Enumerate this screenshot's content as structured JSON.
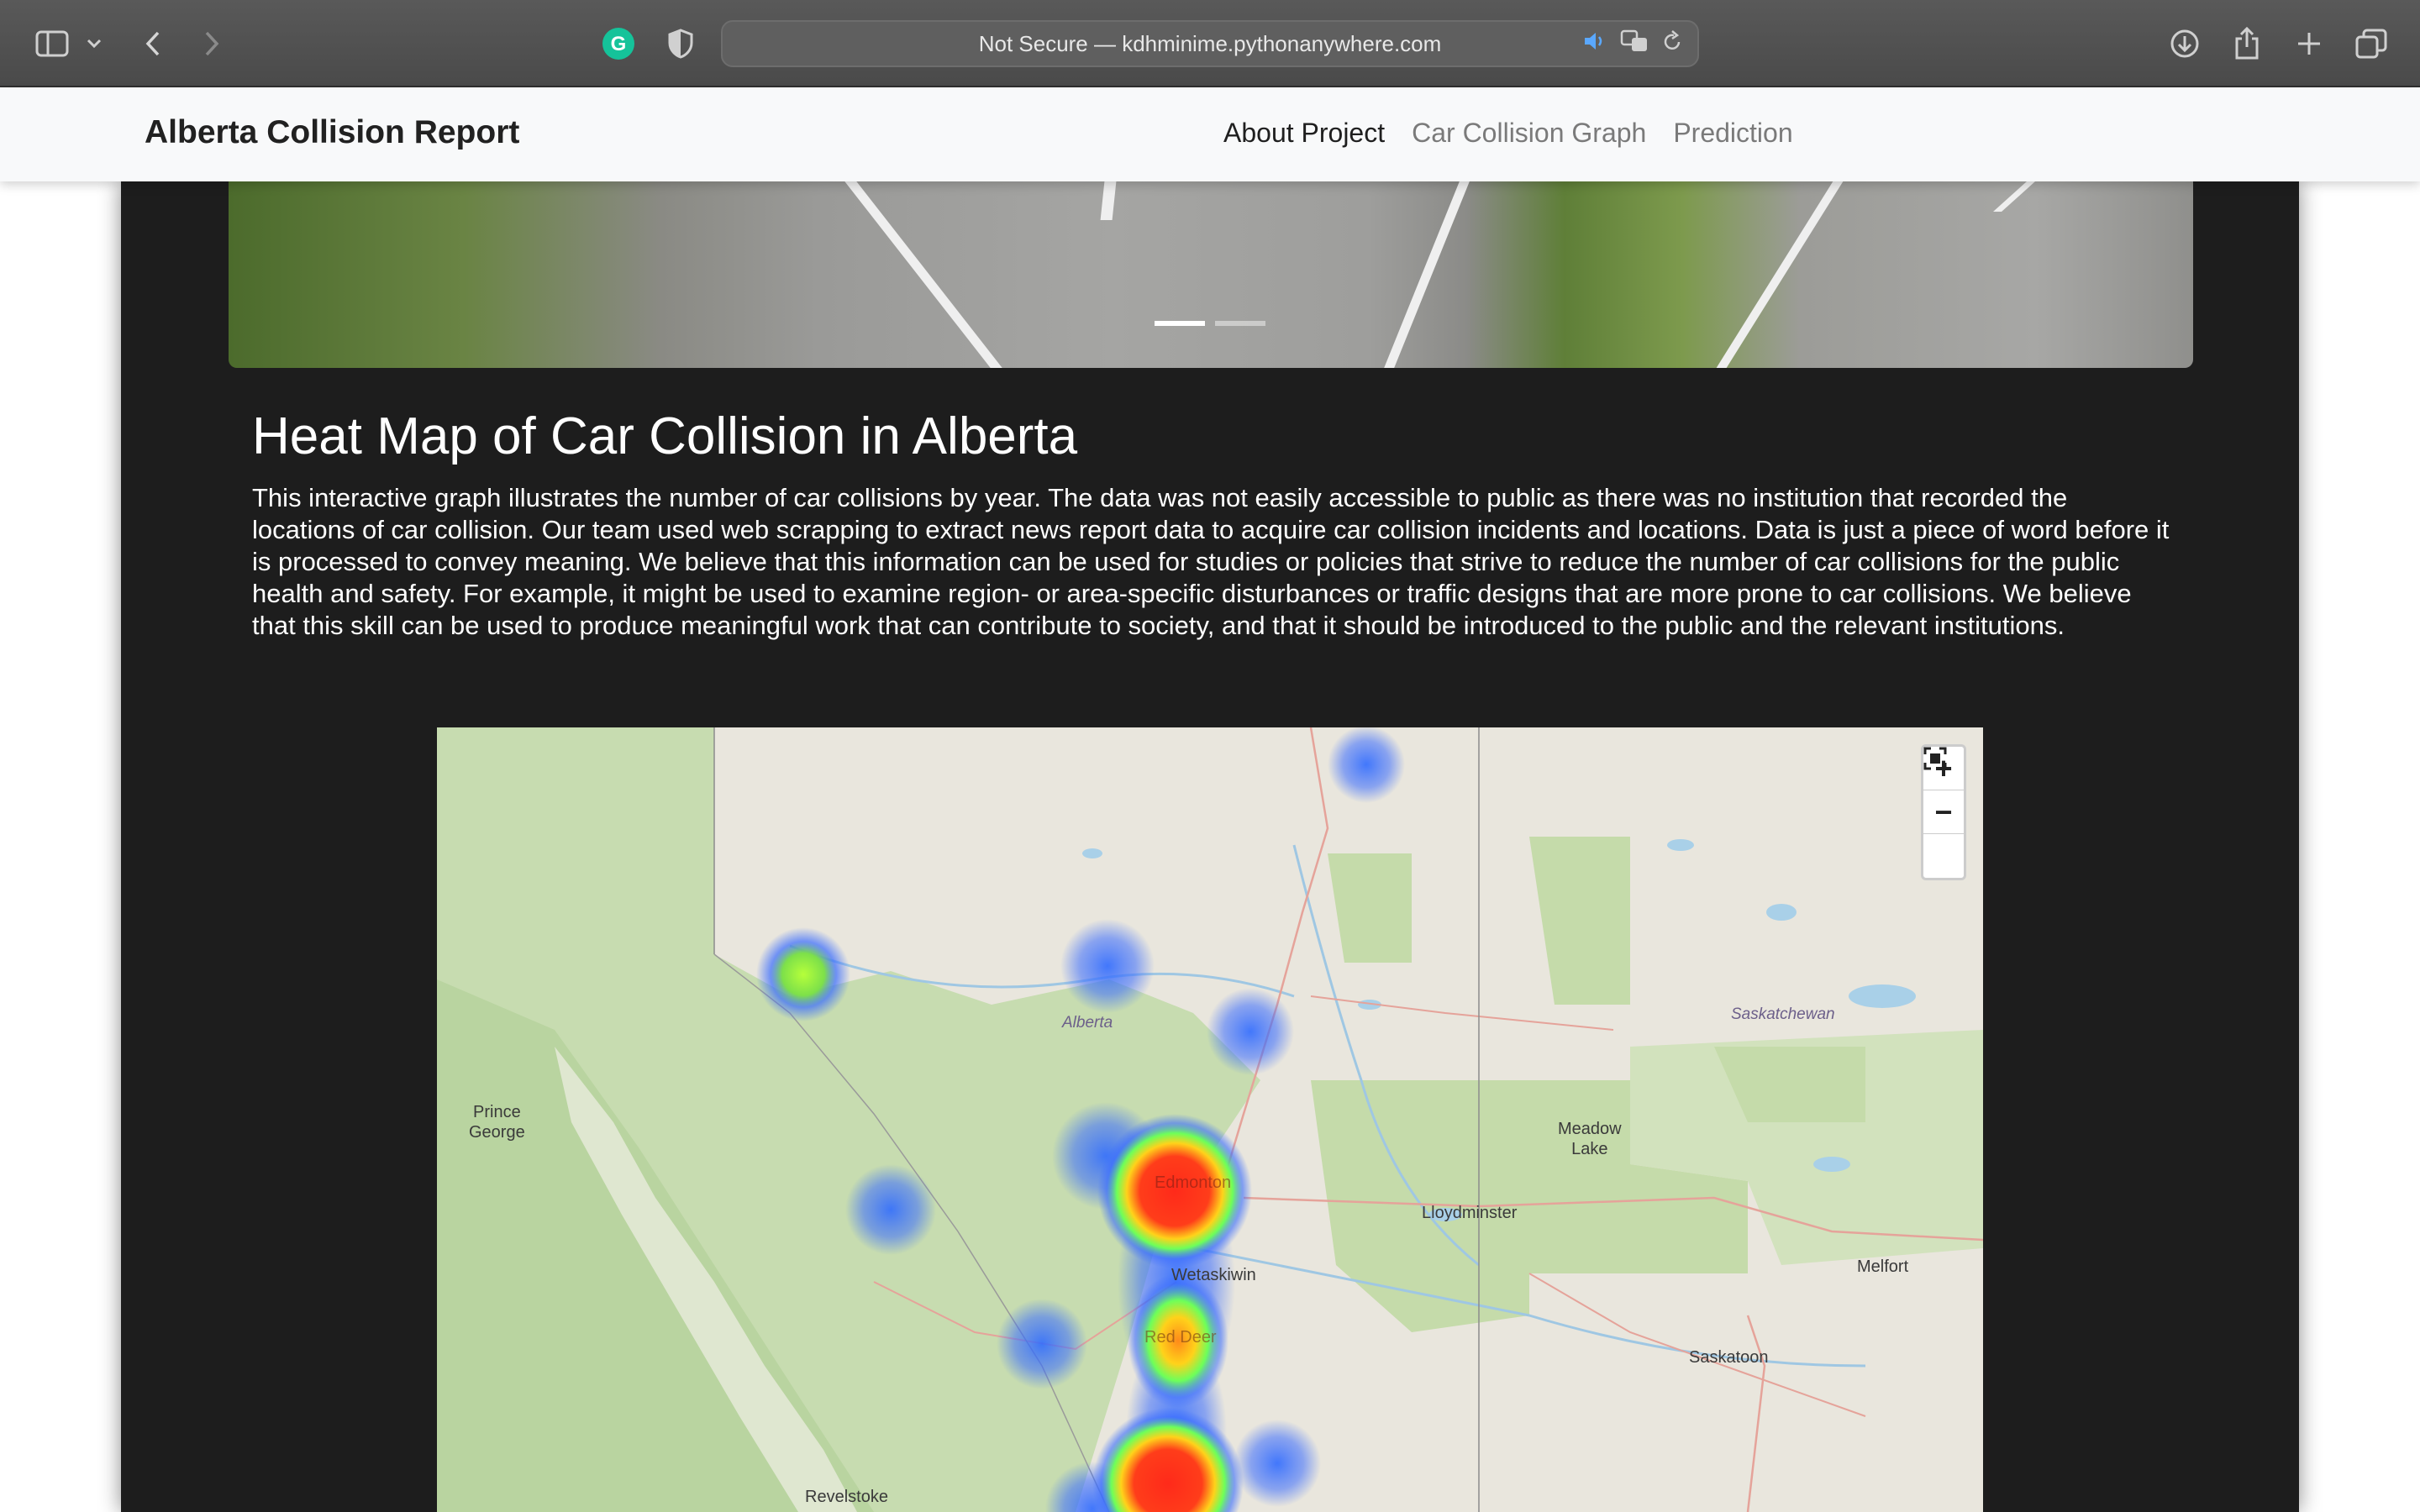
{
  "browser": {
    "address_text": "Not Secure — kdhminime.pythonanywhere.com"
  },
  "navbar": {
    "brand": "Alberta Collision Report",
    "links": [
      "About Project",
      "Car Collision Graph",
      "Prediction"
    ],
    "active_index": 0
  },
  "carousel": {
    "indicator_count": 2,
    "active_indicator": 0
  },
  "content": {
    "heading": "Heat Map of Car Collision in Alberta",
    "description": "This interactive graph illustrates the number of car collisions by year. The data was not easily accessible to public as there was no institution that recorded the locations of car collision. Our team used web scrapping to extract news report data to acquire car collision incidents and locations. Data is just a piece of word before it is processed to convey meaning. We believe that this information can be used for studies or policies that strive to reduce the number of car collisions for the public health and safety. For example, it might be used to examine region- or area-specific disturbances or traffic designs that are more prone to car collisions. We believe that this skill can be used to produce meaningful work that can contribute to society, and that it should be introduced to the public and the relevant institutions."
  },
  "map": {
    "labels": {
      "alberta": "Alberta",
      "saskatchewan": "Saskatchewan",
      "prince_george": "Prince\nGeorge",
      "meadow_lake": "Meadow\nLake",
      "lloydminster": "Lloydminster",
      "edmonton": "Edmonton",
      "wetaskiwin": "Wetaskiwin",
      "red_deer": "Red Deer",
      "melfort": "Melfort",
      "saskatoon": "Saskatoon",
      "revelstoke": "Revelstoke"
    },
    "controls": {
      "zoom_in": "+",
      "zoom_out": "−",
      "fullscreen": "⛶"
    }
  },
  "colors": {
    "panel_background": "#1d1d1d",
    "heat_low": "#3a6cff",
    "heat_mid": "#a8ff3c",
    "heat_high": "#ff2a1a"
  }
}
